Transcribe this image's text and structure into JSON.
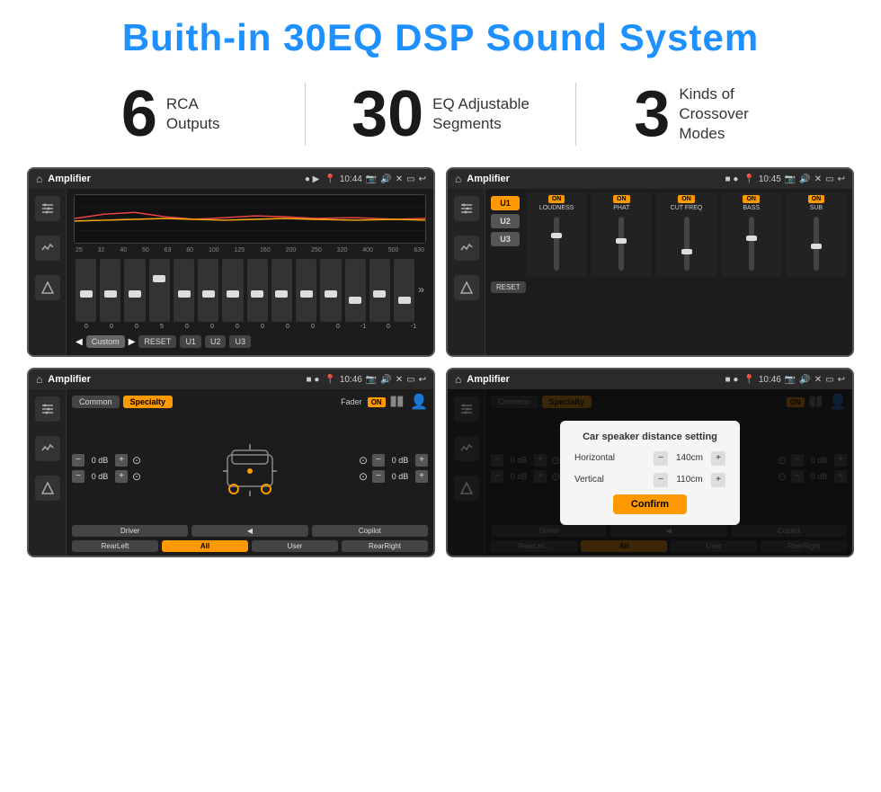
{
  "header": {
    "title": "Buith-in 30EQ DSP Sound System"
  },
  "stats": [
    {
      "number": "6",
      "label": "RCA\nOutputs"
    },
    {
      "number": "30",
      "label": "EQ Adjustable\nSegments"
    },
    {
      "number": "3",
      "label": "Kinds of\nCrossover Modes"
    }
  ],
  "screens": {
    "eq_screen": {
      "app_name": "Amplifier",
      "time": "10:44",
      "eq_labels": [
        "25",
        "32",
        "40",
        "50",
        "63",
        "80",
        "100",
        "125",
        "160",
        "200",
        "250",
        "320",
        "400",
        "500",
        "630"
      ],
      "eq_values": [
        "0",
        "0",
        "0",
        "5",
        "0",
        "0",
        "0",
        "0",
        "0",
        "0",
        "0",
        "-1",
        "0",
        "-1"
      ],
      "preset_buttons": [
        "Custom",
        "RESET",
        "U1",
        "U2",
        "U3"
      ]
    },
    "dsp_screen": {
      "app_name": "Amplifier",
      "time": "10:45",
      "u_buttons": [
        "U1",
        "U2",
        "U3"
      ],
      "channels": [
        "LOUDNESS",
        "PHAT",
        "CUT FREQ",
        "BASS",
        "SUB"
      ],
      "reset_label": "RESET"
    },
    "fader_screen": {
      "app_name": "Amplifier",
      "time": "10:46",
      "tabs": [
        "Common",
        "Specialty"
      ],
      "fader_label": "Fader",
      "on_label": "ON",
      "db_values": [
        "0 dB",
        "0 dB",
        "0 dB",
        "0 dB"
      ],
      "bottom_buttons": [
        "Driver",
        "",
        "Copilot",
        "RearLeft",
        "All",
        "User",
        "RearRight"
      ]
    },
    "dialog_screen": {
      "app_name": "Amplifier",
      "time": "10:46",
      "tabs": [
        "Common",
        "Specialty"
      ],
      "on_label": "ON",
      "dialog_title": "Car speaker distance setting",
      "horizontal_label": "Horizontal",
      "horizontal_value": "140cm",
      "vertical_label": "Vertical",
      "vertical_value": "110cm",
      "confirm_label": "Confirm",
      "db_values": [
        "0 dB",
        "0 dB"
      ],
      "bottom_buttons": [
        "Driver",
        "",
        "Copilot",
        "RearLef...",
        "All",
        "User",
        "RearRight"
      ]
    }
  }
}
